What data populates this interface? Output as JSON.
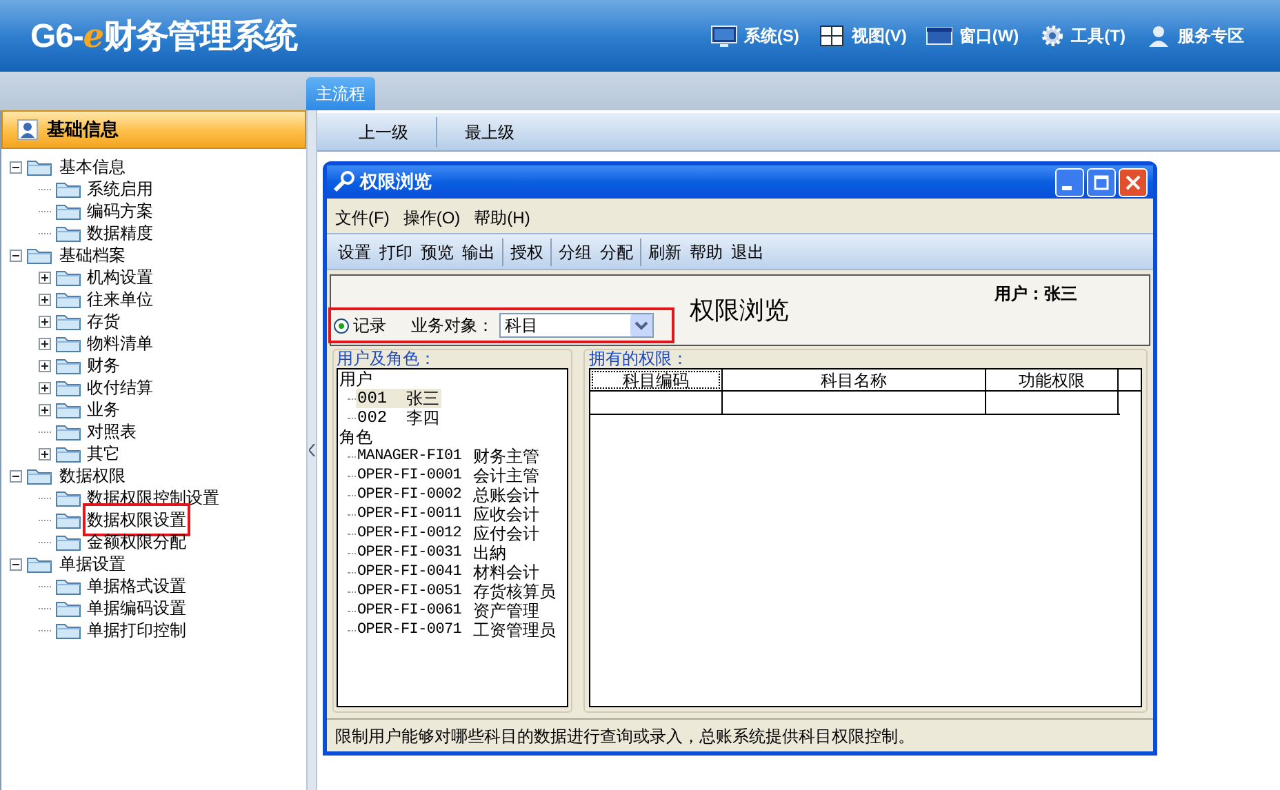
{
  "logo": {
    "prefix": "G6-",
    "mark": "e",
    "name": "财务管理系统"
  },
  "top_menu": [
    {
      "label": "系统(S)",
      "kind": "monitor"
    },
    {
      "label": "视图(V)",
      "kind": "grid"
    },
    {
      "label": "窗口(W)",
      "kind": "window"
    },
    {
      "label": "工具(T)",
      "kind": "gear"
    },
    {
      "label": "服务专区",
      "kind": "person"
    }
  ],
  "tabs": [
    {
      "label": "主流程",
      "selected": true
    }
  ],
  "sidebar": {
    "title": "基础信息",
    "tree": [
      {
        "label": "基本信息",
        "expanded": true,
        "children": [
          {
            "label": "系统启用",
            "kind": "leaf",
            "highlighted": false
          },
          {
            "label": "编码方案",
            "kind": "leaf",
            "highlighted": false
          },
          {
            "label": "数据精度",
            "kind": "leaf",
            "highlighted": false
          }
        ]
      },
      {
        "label": "基础档案",
        "expanded": true,
        "children": [
          {
            "label": "机构设置",
            "kind": "collapsed",
            "highlighted": false
          },
          {
            "label": "往来单位",
            "kind": "collapsed",
            "highlighted": false
          },
          {
            "label": "存货",
            "kind": "collapsed",
            "highlighted": false
          },
          {
            "label": "物料清单",
            "kind": "collapsed",
            "highlighted": false
          },
          {
            "label": "财务",
            "kind": "collapsed",
            "highlighted": false
          },
          {
            "label": "收付结算",
            "kind": "collapsed",
            "highlighted": false
          },
          {
            "label": "业务",
            "kind": "collapsed",
            "highlighted": false
          },
          {
            "label": "对照表",
            "kind": "leaf",
            "highlighted": false
          },
          {
            "label": "其它",
            "kind": "collapsed",
            "highlighted": false
          }
        ]
      },
      {
        "label": "数据权限",
        "expanded": true,
        "children": [
          {
            "label": "数据权限控制设置",
            "kind": "leaf",
            "highlighted": false
          },
          {
            "label": "数据权限设置",
            "kind": "leaf",
            "highlighted": true
          },
          {
            "label": "金额权限分配",
            "kind": "leaf",
            "highlighted": false
          }
        ]
      },
      {
        "label": "单据设置",
        "expanded": true,
        "children": [
          {
            "label": "单据格式设置",
            "kind": "leaf",
            "highlighted": false
          },
          {
            "label": "单据编码设置",
            "kind": "leaf",
            "highlighted": false
          },
          {
            "label": "单据打印控制",
            "kind": "leaf",
            "highlighted": false
          }
        ]
      }
    ]
  },
  "nav_buttons": [
    "上一级",
    "最上级"
  ],
  "dialog": {
    "title": "权限浏览",
    "menu": [
      "文件(F)",
      "操作(O)",
      "帮助(H)"
    ],
    "toolbar": [
      [
        "设置",
        "打印",
        "预览",
        "输出"
      ],
      [
        "授权"
      ],
      [
        "分组",
        "分配"
      ],
      [
        "刷新",
        "帮助",
        "退出"
      ]
    ],
    "heading": "权限浏览",
    "user": "用户：张三",
    "filter": {
      "radio_label": "记录",
      "checked": true,
      "field_label": "业务对象：",
      "value": "科目",
      "highlighted": true
    },
    "users_panel": {
      "legend": "用户及角色：",
      "users_heading": "用户",
      "users": [
        {
          "code": "001",
          "name": "张三",
          "selected": true
        },
        {
          "code": "002",
          "name": "李四",
          "selected": false
        }
      ],
      "roles_heading": "角色",
      "roles": [
        {
          "code": "MANAGER-FI01",
          "name": "财务主管"
        },
        {
          "code": "OPER-FI-0001",
          "name": "会计主管"
        },
        {
          "code": "OPER-FI-0002",
          "name": "总账会计"
        },
        {
          "code": "OPER-FI-0011",
          "name": "应收会计"
        },
        {
          "code": "OPER-FI-0012",
          "name": "应付会计"
        },
        {
          "code": "OPER-FI-0031",
          "name": "出納"
        },
        {
          "code": "OPER-FI-0041",
          "name": "材料会计"
        },
        {
          "code": "OPER-FI-0051",
          "name": "存货核算员"
        },
        {
          "code": "OPER-FI-0061",
          "name": "资产管理"
        },
        {
          "code": "OPER-FI-0071",
          "name": "工资管理员"
        }
      ]
    },
    "permissions_panel": {
      "legend": "拥有的权限：",
      "columns": [
        {
          "label": "科目编码",
          "focused": true
        },
        {
          "label": "科目名称",
          "focused": false
        },
        {
          "label": "功能权限",
          "focused": false
        }
      ]
    },
    "status_bar": "限制用户能够对哪些科目的数据进行查询或录入，总账系统提供科目权限控制。"
  }
}
